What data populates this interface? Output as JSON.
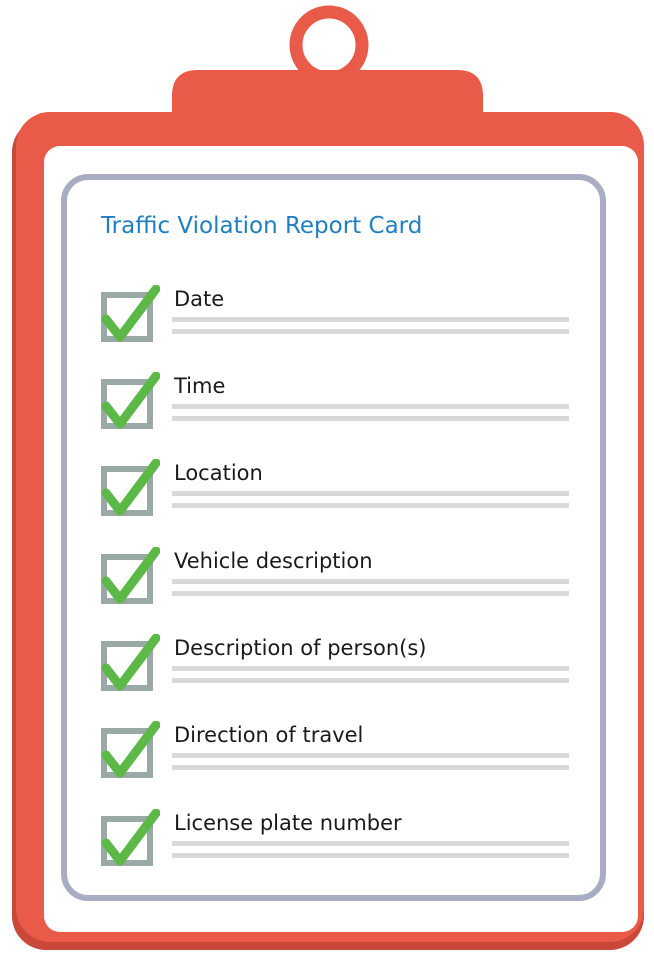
{
  "card": {
    "title": "Traffic Violation Report Card"
  },
  "colors": {
    "board": "#e95a48",
    "board_shadow": "#c9483a",
    "paper_border": "#a9acc2",
    "title": "#1f7fc0",
    "check": "#5cb847",
    "checkbox": "#9aa9a6",
    "write_line": "#d8d9da"
  },
  "items": [
    {
      "label": "Date",
      "checked": true
    },
    {
      "label": "Time",
      "checked": true
    },
    {
      "label": "Location",
      "checked": true
    },
    {
      "label": "Vehicle description",
      "checked": true
    },
    {
      "label": "Description of person(s)",
      "checked": true
    },
    {
      "label": "Direction of travel",
      "checked": true
    },
    {
      "label": "License plate number",
      "checked": true
    }
  ]
}
